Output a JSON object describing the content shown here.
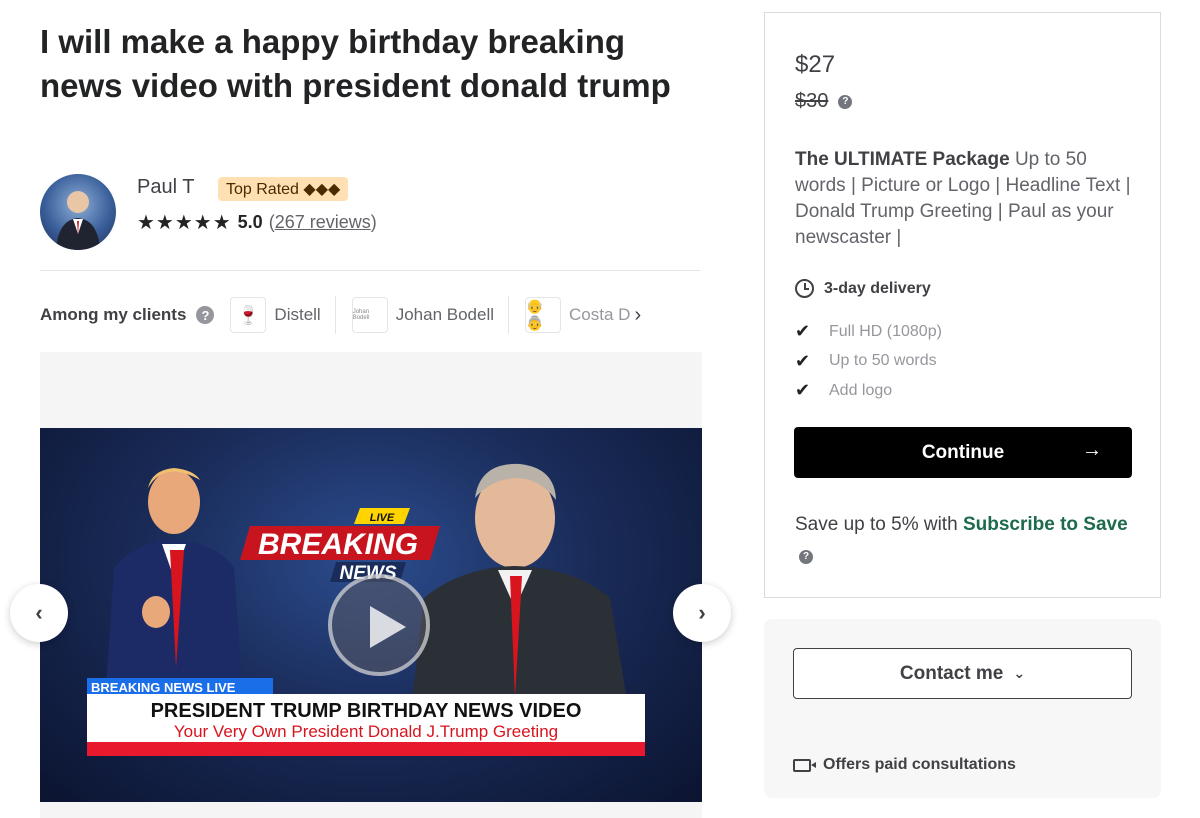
{
  "gig": {
    "title": "I will make a happy birthday breaking news video with president donald trump"
  },
  "seller": {
    "name": "Paul T",
    "badge": "Top Rated ◆◆◆",
    "stars": "★★★★★",
    "rating": "5.0",
    "reviews_open": "(",
    "reviews_link": "267 reviews",
    "reviews_close": ")"
  },
  "clients": {
    "label": "Among my clients",
    "items": [
      {
        "name": "Distell",
        "logo_text": "🍷"
      },
      {
        "name": "Johan Bodell",
        "logo_text": "Johan Bodell"
      },
      {
        "name": "Costa D",
        "logo_text": "👴👵"
      }
    ],
    "next_icon": "›"
  },
  "video": {
    "trump_label": "",
    "breaking_live": "LIVE",
    "breaking_word": "BREAKING",
    "news_word": "NEWS",
    "ticker_label": "BREAKING NEWS LIVE",
    "ticker_main": "PRESIDENT TRUMP BIRTHDAY NEWS VIDEO",
    "ticker_sub": "Your Very Own President Donald J.Trump Greeting"
  },
  "gallery_nav": {
    "prev": "‹",
    "next": "›"
  },
  "package": {
    "price": "$27",
    "old_price": "$30",
    "name": "The ULTIMATE Package",
    "description": " Up to 50 words | Picture or Logo | Headline Text | Donald Trump Greeting | Paul as your newscaster |",
    "delivery": "3-day delivery",
    "features": [
      "Full HD (1080p)",
      "Up to 50 words",
      "Add logo"
    ],
    "continue_label": "Continue",
    "continue_arrow": "→",
    "save_prefix": "Save up to 5% with ",
    "save_link": "Subscribe to Save"
  },
  "contact": {
    "button_label": "Contact me",
    "chevron": "⌄",
    "consult_label": "Offers paid consultations"
  },
  "colors": {
    "primary_button": "#000000",
    "link_green": "#1d6b4c",
    "top_rated_bg": "#ffe0b3"
  }
}
